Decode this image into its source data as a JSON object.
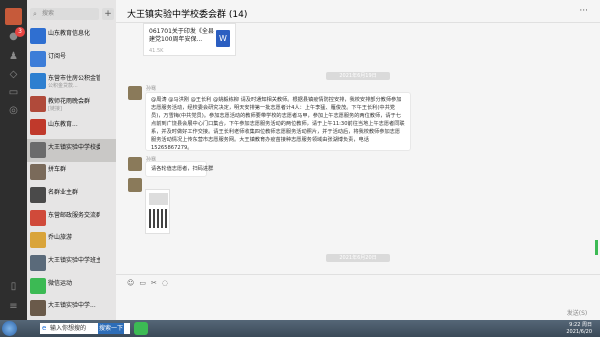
{
  "nav": {
    "badge": "3"
  },
  "search": {
    "placeholder": "搜索",
    "plus": "+"
  },
  "chats": [
    {
      "name": "山东教育信息化",
      "sub": "",
      "time": "",
      "color": "#2f6fd1"
    },
    {
      "name": "订阅号",
      "sub": "",
      "time": "",
      "color": "#3d7dd8"
    },
    {
      "name": "东营市住房公积金管理...",
      "sub": "公积金贷款...",
      "time": "",
      "color": "#2d7fd0"
    },
    {
      "name": "教师花雨晚会群",
      "sub": "[链接]",
      "time": "",
      "color": "#b04a3a"
    },
    {
      "name": "山东教育...",
      "sub": "",
      "time": "",
      "color": "#c0392b"
    },
    {
      "name": "大王镇实验中学校委会群",
      "sub": "",
      "time": "",
      "color": "#6b6b6b"
    },
    {
      "name": "拼车群",
      "sub": "",
      "time": "",
      "color": "#7a6a5a"
    },
    {
      "name": "名群业主群",
      "sub": "",
      "time": "",
      "color": "#4a4a4a"
    },
    {
      "name": "东营邮政服务交流群",
      "sub": "",
      "time": "",
      "color": "#d04a3a"
    },
    {
      "name": "乔山旅游",
      "sub": "",
      "time": "",
      "color": "#d9a43a"
    },
    {
      "name": "大王镇实验中学班主任...",
      "sub": "",
      "time": "",
      "color": "#5a6a7a"
    },
    {
      "name": "微信运动",
      "sub": "",
      "time": "",
      "color": "#3cba54"
    },
    {
      "name": "大王镇实验中学...",
      "sub": "",
      "time": "",
      "color": "#6a5a4a"
    }
  ],
  "chat": {
    "title": "大王镇实验中学校委会群 (14)",
    "more": "···",
    "file": {
      "name": "061701关于印发《全县建党100周年安保...",
      "size": "41.5K",
      "icon": "W"
    },
    "ts1": "2021年6月19日",
    "sender1": "孙骞",
    "msg1": "@周涛 @马洪刚 @王长利 @姚毅栋柳 请及时通知相关教师。根据县镇疫情防控安排，我校安排部分教师参加志愿服务活动，经校委会研究决定，明天安排第一批志愿者计4人：上午李猛、雁俊茂。下午王长利(中共党员)，万雪梅(中共党员)。参加志愿活动的教师要带学校的志愿者马甲，参加上午志愿服务的两位教师，请于七点前到广饶县会展中心门口集合，下午参加志愿服务活动的两位教师，请于上午11:30前往当地上午志愿者同联系，并及时做好工作交接。请王长利老师收集四位教师志愿服务活动照片，并于活动后，将我校教师参加志愿服务活动情况上传东营市志愿服务网。大王镇教育办疫苗接种志愿服务领域由张湖博负责，电话15265867279。",
    "sender2": "孙骞",
    "msg2": "请各轮值志愿者，扫码进群",
    "ts2": "2021年6月20日",
    "send": "发送(S)"
  },
  "taskbar": {
    "input": "输入你想搜的",
    "go": "搜索一下",
    "time": "9:22 周日",
    "date": "2021/6/20"
  }
}
